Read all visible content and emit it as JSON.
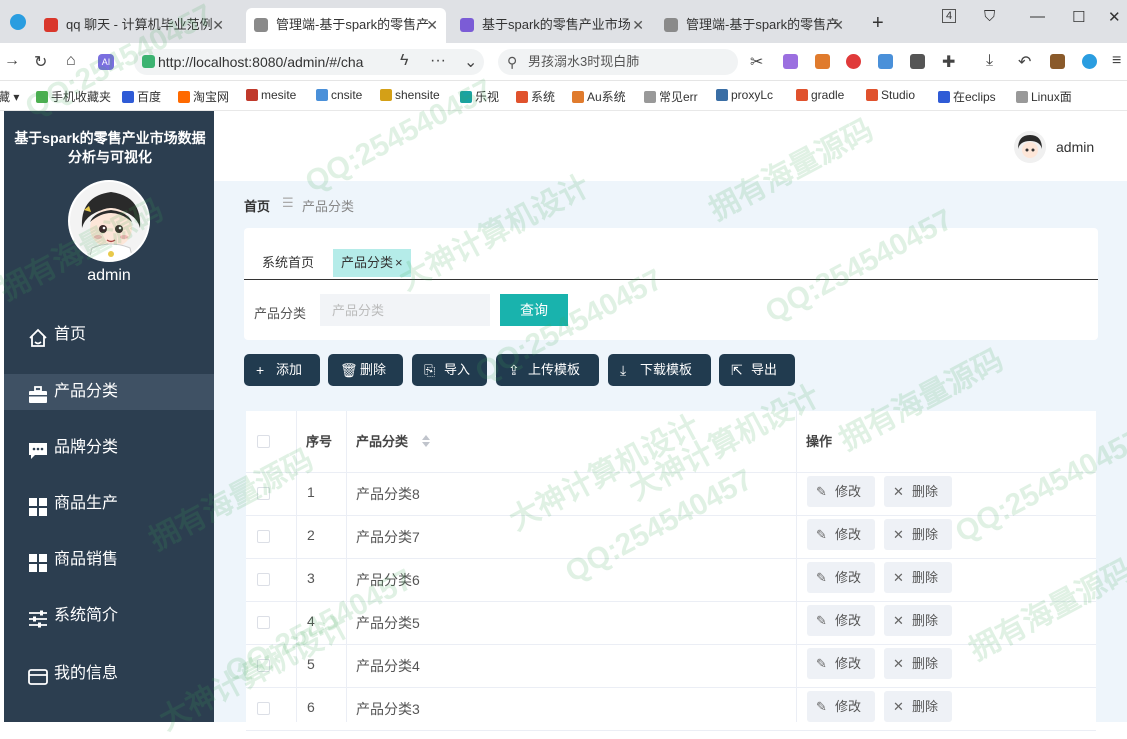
{
  "browser": {
    "tabs": [
      {
        "title": "qq 聊天 - 计算机毕业范例",
        "active": false,
        "fav_color": "#d9372b"
      },
      {
        "title": "管理端-基于spark的零售产",
        "active": true,
        "fav_color": "#8a8a8a"
      },
      {
        "title": "基于spark的零售产业市场",
        "active": false,
        "fav_color": "#7b5cd6"
      },
      {
        "title": "管理端-基于spark的零售产",
        "active": false,
        "fav_color": "#8a8a8a"
      }
    ],
    "new_tab_label": "+",
    "window_badge": "4",
    "address": "http://localhost:8080/admin/#/cha",
    "search_text": "男孩溺水3时现白肺",
    "more_label": "···",
    "bookmarks": [
      {
        "label": "藏 ▾",
        "color": "#ffffff"
      },
      {
        "label": "手机收藏夹",
        "color": "#4caf50"
      },
      {
        "label": "百度",
        "color": "#2f5bd6"
      },
      {
        "label": "淘宝网",
        "color": "#ff6a00"
      },
      {
        "label": "mesite",
        "color": "#c0392b"
      },
      {
        "label": "cnsite",
        "color": "#4a90d9"
      },
      {
        "label": "shensite",
        "color": "#d4a017"
      },
      {
        "label": "乐视",
        "color": "#1aa3a3"
      },
      {
        "label": "系统",
        "color": "#e0522d"
      },
      {
        "label": "Au系统",
        "color": "#e07b2d"
      },
      {
        "label": "常见err",
        "color": "#999999"
      },
      {
        "label": "proxyLc",
        "color": "#3a6ea5"
      },
      {
        "label": "gradle",
        "color": "#e0522d"
      },
      {
        "label": "Studio",
        "color": "#e0522d"
      },
      {
        "label": "在eclips",
        "color": "#2f5bd6"
      },
      {
        "label": "Linux面",
        "color": "#999999"
      }
    ]
  },
  "sidebar": {
    "title": "基于spark的零售产业市场数据分析与可视化",
    "username": "admin",
    "menu": [
      {
        "label": "首页",
        "icon": "home-icon",
        "active": false
      },
      {
        "label": "产品分类",
        "icon": "briefcase-icon",
        "active": true
      },
      {
        "label": "品牌分类",
        "icon": "chat-icon",
        "active": false
      },
      {
        "label": "商品生产",
        "icon": "grid-icon",
        "active": false
      },
      {
        "label": "商品销售",
        "icon": "grid-icon",
        "active": false
      },
      {
        "label": "系统简介",
        "icon": "sliders-icon",
        "active": false
      },
      {
        "label": "我的信息",
        "icon": "card-icon",
        "active": false
      }
    ]
  },
  "header": {
    "username": "admin"
  },
  "breadcrumb": {
    "home": "首页",
    "separator": "☰",
    "current": "产品分类"
  },
  "tabs": [
    {
      "label": "系统首页",
      "active": false
    },
    {
      "label": "产品分类",
      "active": true,
      "close": "×"
    }
  ],
  "search": {
    "label": "产品分类",
    "placeholder": "产品分类",
    "value": "",
    "button": "查询"
  },
  "toolbar": [
    {
      "label": "添加",
      "icon": "plus-icon",
      "glyph": "+"
    },
    {
      "label": "删除",
      "icon": "trash-icon",
      "glyph": "🗑"
    },
    {
      "label": "导入",
      "icon": "import-icon",
      "glyph": "⎘"
    },
    {
      "label": "上传模板",
      "icon": "upload-icon",
      "glyph": "⇪"
    },
    {
      "label": "下载模板",
      "icon": "download-icon",
      "glyph": "⤓"
    },
    {
      "label": "导出",
      "icon": "export-icon",
      "glyph": "⇱"
    }
  ],
  "table": {
    "columns": [
      "序号",
      "产品分类",
      "操作"
    ],
    "edit_label": "修改",
    "delete_label": "删除",
    "rows": [
      {
        "index": "1",
        "name": "产品分类8"
      },
      {
        "index": "2",
        "name": "产品分类7"
      },
      {
        "index": "3",
        "name": "产品分类6"
      },
      {
        "index": "4",
        "name": "产品分类5"
      },
      {
        "index": "5",
        "name": "产品分类4"
      },
      {
        "index": "6",
        "name": "产品分类3"
      }
    ]
  },
  "watermarks": [
    "QQ:254540457",
    "拥有海量源码",
    "大神计算机设计"
  ]
}
